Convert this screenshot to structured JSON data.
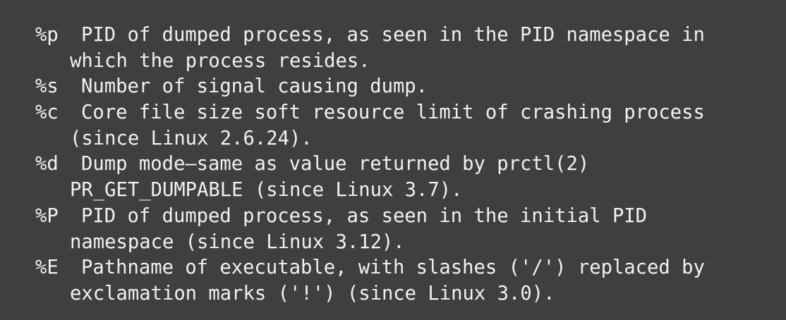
{
  "entries": [
    {
      "specifier": "%p",
      "lines": [
        "PID of dumped process, as seen in the PID namespace in",
        "which the process resides."
      ]
    },
    {
      "specifier": "%s",
      "lines": [
        "Number of signal causing dump."
      ]
    },
    {
      "specifier": "%c",
      "lines": [
        "Core file size soft resource limit of crashing process",
        "(since Linux 2.6.24)."
      ]
    },
    {
      "specifier": "%d",
      "lines": [
        "Dump mode—same as value returned by prctl(2)",
        "PR_GET_DUMPABLE (since Linux 3.7)."
      ]
    },
    {
      "specifier": "%P",
      "lines": [
        "PID of dumped process, as seen in the initial PID",
        "namespace (since Linux 3.12)."
      ]
    },
    {
      "specifier": "%E",
      "lines": [
        "Pathname of executable, with slashes ('/') replaced by",
        "exclamation marks ('!') (since Linux 3.0)."
      ]
    }
  ]
}
